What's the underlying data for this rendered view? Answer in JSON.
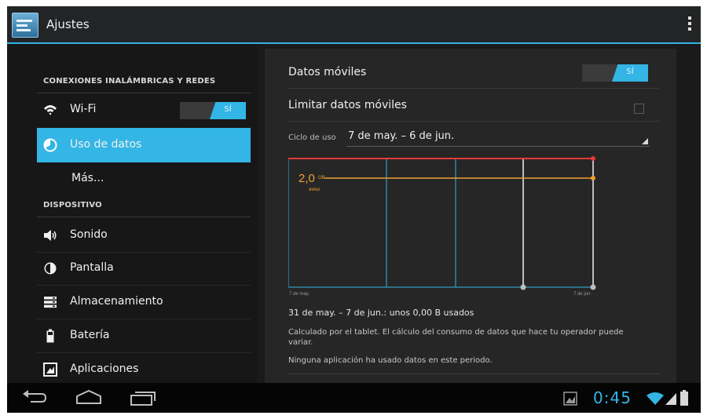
{
  "action_bar": {
    "title": "Ajustes"
  },
  "sidebar": {
    "section_wireless": "CONEXIONES INALÁMBRICAS Y REDES",
    "wifi": {
      "label": "Wi-Fi",
      "toggle": "SÍ"
    },
    "data_usage": {
      "label": "Uso de datos"
    },
    "more": {
      "label": "Más..."
    },
    "section_device": "DISPOSITIVO",
    "sound": {
      "label": "Sonido"
    },
    "display": {
      "label": "Pantalla"
    },
    "storage": {
      "label": "Almacenamiento"
    },
    "battery": {
      "label": "Batería"
    },
    "apps": {
      "label": "Aplicaciones"
    }
  },
  "main": {
    "mobile_data": {
      "label": "Datos móviles",
      "toggle": "SÍ"
    },
    "limit_mobile": {
      "label": "Limitar datos móviles",
      "checked": false
    },
    "cycle": {
      "label": "Ciclo de uso",
      "value": "7 de may. – 6 de jun."
    },
    "usage_summary": "31 de may. – 7 de jun.: unos 0,00 B usados",
    "note": "Calculado por el tablet. El cálculo del consumo de datos que hace tu operador puede variar.",
    "no_apps": "Ninguna aplicación ha usado datos en este periodo."
  },
  "chart_data": {
    "type": "line",
    "warning_value": "2,0",
    "warning_unit": "GB",
    "warning_caption": "aviso",
    "x_start_label": "7 de may.",
    "x_end_label": "7 de jun.",
    "colors": {
      "limit": "#e53935",
      "warning": "#f0a030",
      "grid": "#33b5e5",
      "marker": "#bdbdbd"
    }
  },
  "status": {
    "time": "0:45"
  },
  "colors": {
    "accent": "#33b5e5"
  }
}
